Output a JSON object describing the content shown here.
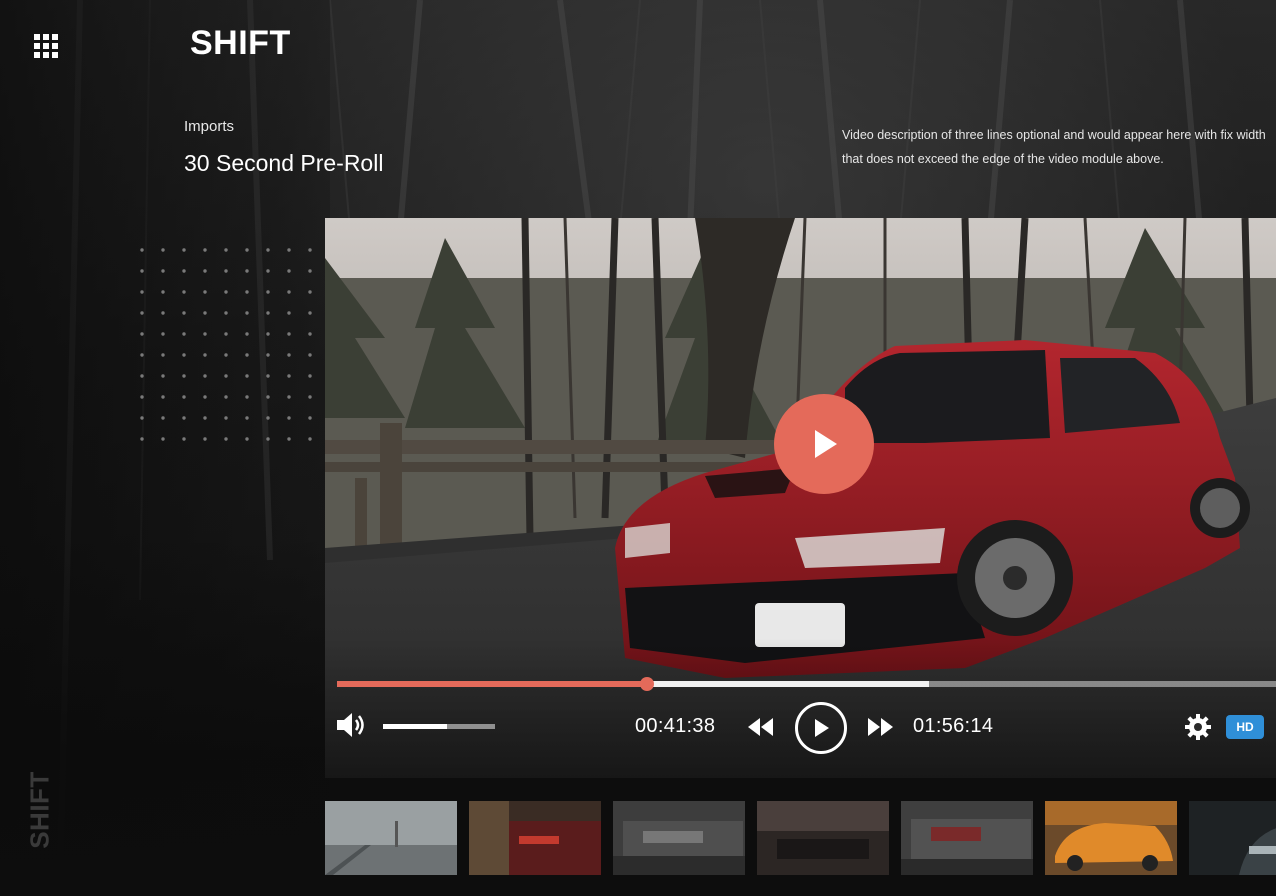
{
  "app": {
    "logo": "SHIFT",
    "side_logo": "SHIFT"
  },
  "header": {
    "section_label": "Imports",
    "video_title": "30 Second Pre-Roll",
    "description": "Video description of three lines optional and would appear here with fix width that does not exceed the edge of the video module above."
  },
  "player": {
    "current_time": "00:41:38",
    "total_time": "01:56:14",
    "played_fraction": 0.33,
    "buffered_fraction": 0.63,
    "volume_fraction": 0.57,
    "quality_badge": "HD",
    "accent_color": "#e46a5a",
    "badge_color": "#2f8fd8"
  },
  "icons": {
    "menu": "grid-icon",
    "big_play": "play-icon",
    "volume": "volume-icon",
    "rewind": "rewind-icon",
    "play": "play-icon",
    "forward": "fast-forward-icon",
    "settings": "gear-icon"
  },
  "thumbnails": [
    {
      "name": "foggy-pier-thumbnail"
    },
    {
      "name": "red-car-rear-thumbnail"
    },
    {
      "name": "parked-cars-thumbnail"
    },
    {
      "name": "car-interior-thumbnail"
    },
    {
      "name": "parked-cars-thumbnail-2"
    },
    {
      "name": "orange-car-thumbnail"
    },
    {
      "name": "dark-car-thumbnail"
    }
  ]
}
